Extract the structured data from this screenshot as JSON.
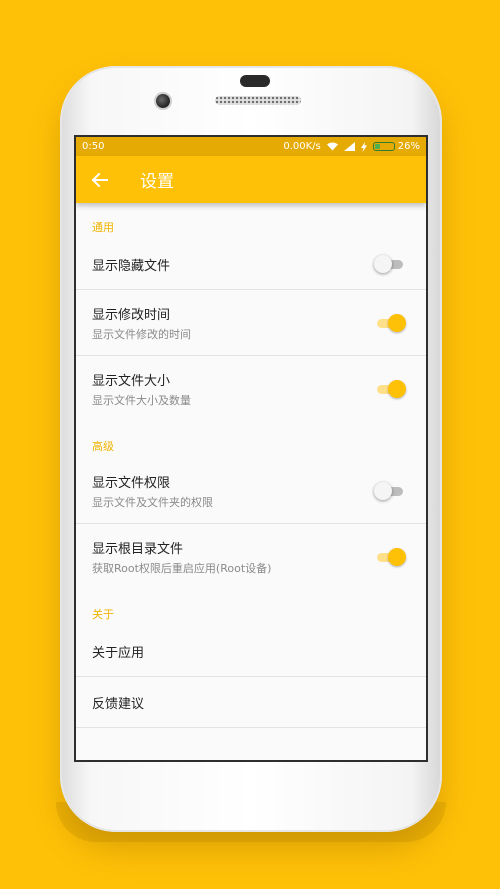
{
  "status_bar": {
    "time": "0:50",
    "network_speed": "0.00K/s",
    "battery": "26%",
    "icons": [
      "wifi-icon",
      "signal-icon",
      "charging-icon",
      "battery-icon"
    ]
  },
  "app_bar": {
    "title": "设置",
    "back_icon": "arrow-left-icon"
  },
  "colors": {
    "accent": "#FFC107",
    "status_bar": "#E6AA05",
    "section_header": "#F0B400"
  },
  "sections": {
    "general": {
      "header": "通用",
      "items": [
        {
          "title": "显示隐藏文件",
          "summary": "",
          "toggle_on": false
        },
        {
          "title": "显示修改时间",
          "summary": "显示文件修改的时间",
          "toggle_on": true
        },
        {
          "title": "显示文件大小",
          "summary": "显示文件大小及数量",
          "toggle_on": true
        }
      ]
    },
    "advanced": {
      "header": "高级",
      "items": [
        {
          "title": "显示文件权限",
          "summary": "显示文件及文件夹的权限",
          "toggle_on": false
        },
        {
          "title": "显示根目录文件",
          "summary": "获取Root权限后重启应用(Root设备)",
          "toggle_on": true
        }
      ]
    },
    "about": {
      "header": "关于",
      "items": [
        {
          "title": "关于应用"
        },
        {
          "title": "反馈建议"
        }
      ]
    }
  }
}
